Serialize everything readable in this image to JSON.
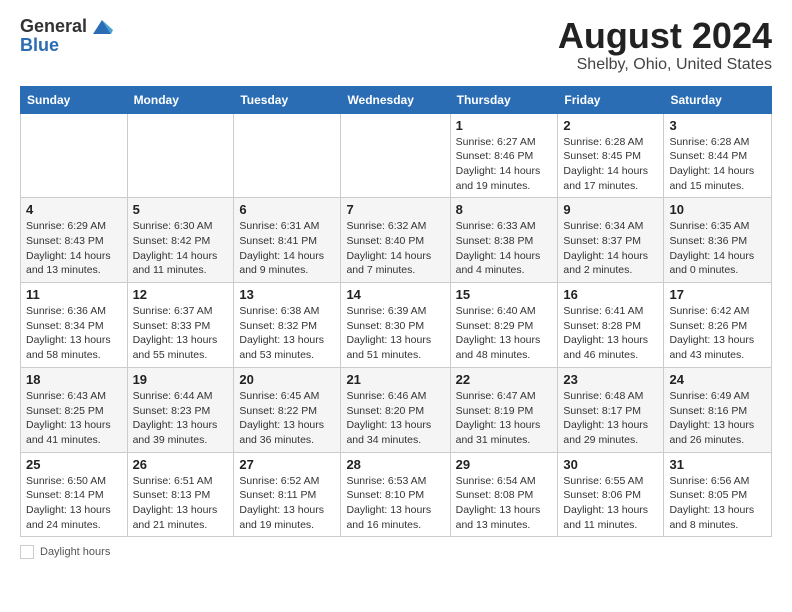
{
  "header": {
    "logo_general": "General",
    "logo_blue": "Blue",
    "title": "August 2024",
    "subtitle": "Shelby, Ohio, United States"
  },
  "weekdays": [
    "Sunday",
    "Monday",
    "Tuesday",
    "Wednesday",
    "Thursday",
    "Friday",
    "Saturday"
  ],
  "weeks": [
    [
      {
        "day": "",
        "info": ""
      },
      {
        "day": "",
        "info": ""
      },
      {
        "day": "",
        "info": ""
      },
      {
        "day": "",
        "info": ""
      },
      {
        "day": "1",
        "info": "Sunrise: 6:27 AM\nSunset: 8:46 PM\nDaylight: 14 hours and 19 minutes."
      },
      {
        "day": "2",
        "info": "Sunrise: 6:28 AM\nSunset: 8:45 PM\nDaylight: 14 hours and 17 minutes."
      },
      {
        "day": "3",
        "info": "Sunrise: 6:28 AM\nSunset: 8:44 PM\nDaylight: 14 hours and 15 minutes."
      }
    ],
    [
      {
        "day": "4",
        "info": "Sunrise: 6:29 AM\nSunset: 8:43 PM\nDaylight: 14 hours and 13 minutes."
      },
      {
        "day": "5",
        "info": "Sunrise: 6:30 AM\nSunset: 8:42 PM\nDaylight: 14 hours and 11 minutes."
      },
      {
        "day": "6",
        "info": "Sunrise: 6:31 AM\nSunset: 8:41 PM\nDaylight: 14 hours and 9 minutes."
      },
      {
        "day": "7",
        "info": "Sunrise: 6:32 AM\nSunset: 8:40 PM\nDaylight: 14 hours and 7 minutes."
      },
      {
        "day": "8",
        "info": "Sunrise: 6:33 AM\nSunset: 8:38 PM\nDaylight: 14 hours and 4 minutes."
      },
      {
        "day": "9",
        "info": "Sunrise: 6:34 AM\nSunset: 8:37 PM\nDaylight: 14 hours and 2 minutes."
      },
      {
        "day": "10",
        "info": "Sunrise: 6:35 AM\nSunset: 8:36 PM\nDaylight: 14 hours and 0 minutes."
      }
    ],
    [
      {
        "day": "11",
        "info": "Sunrise: 6:36 AM\nSunset: 8:34 PM\nDaylight: 13 hours and 58 minutes."
      },
      {
        "day": "12",
        "info": "Sunrise: 6:37 AM\nSunset: 8:33 PM\nDaylight: 13 hours and 55 minutes."
      },
      {
        "day": "13",
        "info": "Sunrise: 6:38 AM\nSunset: 8:32 PM\nDaylight: 13 hours and 53 minutes."
      },
      {
        "day": "14",
        "info": "Sunrise: 6:39 AM\nSunset: 8:30 PM\nDaylight: 13 hours and 51 minutes."
      },
      {
        "day": "15",
        "info": "Sunrise: 6:40 AM\nSunset: 8:29 PM\nDaylight: 13 hours and 48 minutes."
      },
      {
        "day": "16",
        "info": "Sunrise: 6:41 AM\nSunset: 8:28 PM\nDaylight: 13 hours and 46 minutes."
      },
      {
        "day": "17",
        "info": "Sunrise: 6:42 AM\nSunset: 8:26 PM\nDaylight: 13 hours and 43 minutes."
      }
    ],
    [
      {
        "day": "18",
        "info": "Sunrise: 6:43 AM\nSunset: 8:25 PM\nDaylight: 13 hours and 41 minutes."
      },
      {
        "day": "19",
        "info": "Sunrise: 6:44 AM\nSunset: 8:23 PM\nDaylight: 13 hours and 39 minutes."
      },
      {
        "day": "20",
        "info": "Sunrise: 6:45 AM\nSunset: 8:22 PM\nDaylight: 13 hours and 36 minutes."
      },
      {
        "day": "21",
        "info": "Sunrise: 6:46 AM\nSunset: 8:20 PM\nDaylight: 13 hours and 34 minutes."
      },
      {
        "day": "22",
        "info": "Sunrise: 6:47 AM\nSunset: 8:19 PM\nDaylight: 13 hours and 31 minutes."
      },
      {
        "day": "23",
        "info": "Sunrise: 6:48 AM\nSunset: 8:17 PM\nDaylight: 13 hours and 29 minutes."
      },
      {
        "day": "24",
        "info": "Sunrise: 6:49 AM\nSunset: 8:16 PM\nDaylight: 13 hours and 26 minutes."
      }
    ],
    [
      {
        "day": "25",
        "info": "Sunrise: 6:50 AM\nSunset: 8:14 PM\nDaylight: 13 hours and 24 minutes."
      },
      {
        "day": "26",
        "info": "Sunrise: 6:51 AM\nSunset: 8:13 PM\nDaylight: 13 hours and 21 minutes."
      },
      {
        "day": "27",
        "info": "Sunrise: 6:52 AM\nSunset: 8:11 PM\nDaylight: 13 hours and 19 minutes."
      },
      {
        "day": "28",
        "info": "Sunrise: 6:53 AM\nSunset: 8:10 PM\nDaylight: 13 hours and 16 minutes."
      },
      {
        "day": "29",
        "info": "Sunrise: 6:54 AM\nSunset: 8:08 PM\nDaylight: 13 hours and 13 minutes."
      },
      {
        "day": "30",
        "info": "Sunrise: 6:55 AM\nSunset: 8:06 PM\nDaylight: 13 hours and 11 minutes."
      },
      {
        "day": "31",
        "info": "Sunrise: 6:56 AM\nSunset: 8:05 PM\nDaylight: 13 hours and 8 minutes."
      }
    ]
  ],
  "footer": {
    "daylight_label": "Daylight hours"
  }
}
